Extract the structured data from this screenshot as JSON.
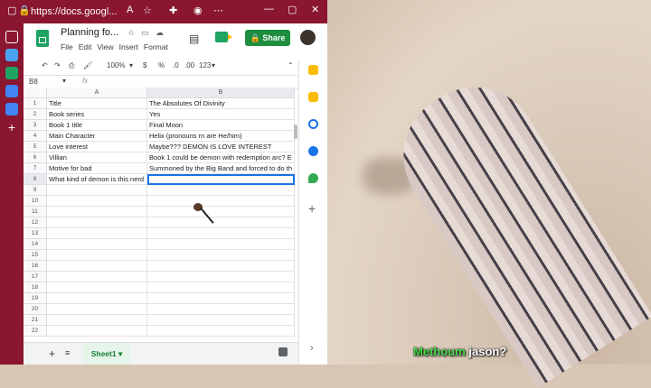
{
  "browser": {
    "url": "https://docs.googl...",
    "icons": [
      "tab-icon",
      "lock-icon",
      "read-aloud-icon",
      "favorites-icon",
      "extensions-icon"
    ]
  },
  "doc": {
    "title": "Planning fo...",
    "menu": [
      "File",
      "Edit",
      "View",
      "Insert",
      "Format"
    ]
  },
  "share_label": "Share",
  "toolbar": {
    "zoom": "100%",
    "currency": "$",
    "percent": "%",
    "dec_less": ".0",
    "dec_more": ".00",
    "format": "123"
  },
  "formula_bar": {
    "name_box": "B8",
    "fx": "fx",
    "value": ""
  },
  "columns": [
    "A",
    "B"
  ],
  "rows": [
    {
      "n": "1",
      "a": "Title",
      "b": "The Absolutes Of Divinity"
    },
    {
      "n": "2",
      "a": "Book series",
      "b": "Yes"
    },
    {
      "n": "3",
      "a": "Book 1 title",
      "b": "Final Moon"
    },
    {
      "n": "4",
      "a": "Main Character",
      "b": "Helix (pronouns rn are He/him)"
    },
    {
      "n": "5",
      "a": "Love interest",
      "b": "Maybe??? DEMON IS LOVE INTEREST"
    },
    {
      "n": "6",
      "a": "Villian",
      "b": "Book 1 could be demon with redemption arc? E"
    },
    {
      "n": "7",
      "a": "Motive for bad",
      "b": "Summoned by the Big Band and forced to do th"
    },
    {
      "n": "8",
      "a": "What kind of demon is this nerd",
      "b": ""
    },
    {
      "n": "9",
      "a": "",
      "b": ""
    },
    {
      "n": "10",
      "a": "",
      "b": ""
    },
    {
      "n": "11",
      "a": "",
      "b": ""
    },
    {
      "n": "12",
      "a": "",
      "b": ""
    },
    {
      "n": "13",
      "a": "",
      "b": ""
    },
    {
      "n": "14",
      "a": "",
      "b": ""
    },
    {
      "n": "15",
      "a": "",
      "b": ""
    },
    {
      "n": "16",
      "a": "",
      "b": ""
    },
    {
      "n": "17",
      "a": "",
      "b": ""
    },
    {
      "n": "18",
      "a": "",
      "b": ""
    },
    {
      "n": "19",
      "a": "",
      "b": ""
    },
    {
      "n": "20",
      "a": "",
      "b": ""
    },
    {
      "n": "21",
      "a": "",
      "b": ""
    },
    {
      "n": "22",
      "a": "",
      "b": ""
    }
  ],
  "selected_cell": "B8",
  "sheet_tab": "Sheet1",
  "caption": {
    "highlight": "Methoum",
    "rest": " jason?"
  },
  "colors": {
    "titlebar": "#8a1630",
    "share": "#1e8e3e",
    "selection": "#1a73e8",
    "sheet_tab": "#188038"
  }
}
